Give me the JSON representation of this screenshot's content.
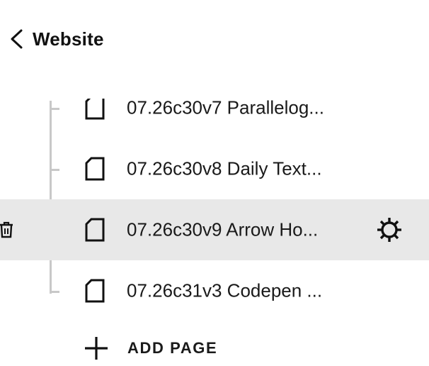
{
  "header": {
    "back_icon": "chevron-left-icon",
    "title": "Website"
  },
  "pages": [
    {
      "label": "07.26c30v7 Parallelog...",
      "icon": "page-icon",
      "selected": false
    },
    {
      "label": "07.26c30v8 Daily Text...",
      "icon": "page-icon",
      "selected": false
    },
    {
      "label": "07.26c30v9 Arrow Ho...",
      "icon": "page-icon",
      "selected": true,
      "actions": [
        "trash-icon",
        "gear-icon"
      ]
    },
    {
      "label": "07.26c31v3 Codepen ...",
      "icon": "page-icon",
      "selected": false
    }
  ],
  "add_page": {
    "icon": "plus-icon",
    "label": "ADD PAGE"
  },
  "colors": {
    "selected_row_bg": "#e8e8e8",
    "tree_line": "#c8c8c8",
    "text": "#1a1a1a"
  }
}
